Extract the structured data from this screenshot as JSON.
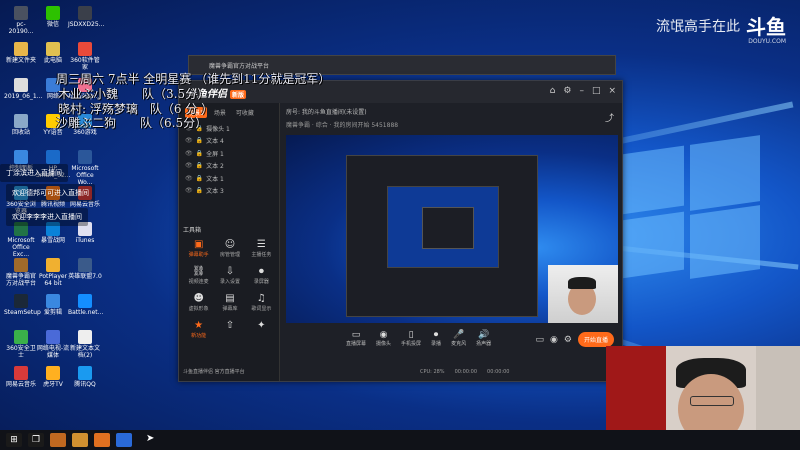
{
  "watermark": {
    "text": "流氓高手在此",
    "logo": "斗鱼",
    "url": "DOUYU.COM"
  },
  "overlay_lines": [
    "周三周六 7点半 全明星赛 （谁先到11分就是冠军）",
    "木业ぶ小魏　　队（3.5分）",
    "晓村: 浮殇梦璃　队（6 分 ）",
    "沙雕ぶ二狗　　队（6.5分）"
  ],
  "chat_messages": [
    "丁涂滨进入直播间",
    "欢迎德邦可可进入直播间",
    "欢迎李李李进入直播间"
  ],
  "desktop_icons": [
    {
      "label": "pc-20190...",
      "icon": "computer-icon",
      "color": "#4a5160"
    },
    {
      "label": "微信",
      "icon": "wechat-icon",
      "color": "#2dc100"
    },
    {
      "label": "JSDXXD25...",
      "icon": "file-icon",
      "color": "#3a3f4a"
    },
    {
      "label": "新建文件夹",
      "icon": "folder-icon",
      "color": "#e8b64a"
    },
    {
      "label": "此电脑",
      "icon": "pc-icon",
      "color": "#e0c050"
    },
    {
      "label": "360软件管家",
      "icon": "app-icon",
      "color": "#e94a3a"
    },
    {
      "label": "2019_06_1...",
      "icon": "file-icon",
      "color": "#ddd"
    },
    {
      "label": "网络",
      "icon": "network-icon",
      "color": "#3a7cd8"
    },
    {
      "label": "bilibiliupl...",
      "icon": "app-icon",
      "color": "#f07090"
    },
    {
      "label": "回收站",
      "icon": "recycle-bin-icon",
      "color": "#8aa8c8"
    },
    {
      "label": "YY语音",
      "icon": "app-icon",
      "color": "#ffcc00"
    },
    {
      "label": "360游戏",
      "icon": "app-icon",
      "color": "#2a8ad8"
    },
    {
      "label": "控制面板",
      "icon": "control-panel-icon",
      "color": "#3a88e0"
    },
    {
      "label": "HP Smart_02...",
      "icon": "app-icon",
      "color": "#1a6ac8"
    },
    {
      "label": "Microsoft Office Wo...",
      "icon": "word-icon",
      "color": "#2b579a"
    },
    {
      "label": "360安全浏览器",
      "icon": "browser-icon",
      "color": "#2a9ae0"
    },
    {
      "label": "腾讯视频",
      "icon": "app-icon",
      "color": "#ff7a1a"
    },
    {
      "label": "网易云音乐",
      "icon": "app-icon",
      "color": "#d83a3a"
    },
    {
      "label": "Microsoft Office Exc...",
      "icon": "excel-icon",
      "color": "#217346"
    },
    {
      "label": "暴雪战网",
      "icon": "app-icon",
      "color": "#0a82d8"
    },
    {
      "label": "iTunes",
      "icon": "app-icon",
      "color": "#e0e0f0"
    },
    {
      "label": "魔兽争霸官方对战平台",
      "icon": "app-icon",
      "color": "#a06a2a"
    },
    {
      "label": "PotPlayer 64 bit",
      "icon": "app-icon",
      "color": "#f0b030"
    },
    {
      "label": "英雄联盟7.0",
      "icon": "app-icon",
      "color": "#3a5a8a"
    },
    {
      "label": "SteamSetup",
      "icon": "steam-icon",
      "color": "#1b2838"
    },
    {
      "label": "爱剪辑",
      "icon": "app-icon",
      "color": "#3a88e0"
    },
    {
      "label": "Battle.net...",
      "icon": "app-icon",
      "color": "#148eff"
    },
    {
      "label": "360安全卫士",
      "icon": "app-icon",
      "color": "#3ab04a"
    },
    {
      "label": "网络电视-流媒体",
      "icon": "app-icon",
      "color": "#4a6ad8"
    },
    {
      "label": "新建文本文档(2)",
      "icon": "file-icon",
      "color": "#eee"
    },
    {
      "label": "网易云音乐",
      "icon": "app-icon",
      "color": "#d83a3a"
    },
    {
      "label": "虎牙TV",
      "icon": "app-icon",
      "color": "#ffb020"
    },
    {
      "label": "腾讯QQ",
      "icon": "qq-icon",
      "color": "#1a9af0"
    }
  ],
  "back_window": {
    "title": "魔兽争霸官方对战平台"
  },
  "obs": {
    "logo": "斗鱼伴侣",
    "badge": "新版",
    "tabs": [
      "场景1",
      "场景",
      "可收藏"
    ],
    "top_info": "房号: 我的斗鱼直播间(未设置)",
    "info_line2": "魔兽争霸 · 综合 · 我的房间开始 5451888",
    "scenes": [
      "摄像头 1",
      "文本 4",
      "全屏 1",
      "文本 2",
      "文本 1",
      "文本 3"
    ],
    "tools_title": "工具箱",
    "tools": [
      {
        "label": "弹幕助手",
        "icon": "danmaku-icon",
        "hot": true
      },
      {
        "label": "房管管理",
        "icon": "user-icon",
        "hot": false
      },
      {
        "label": "主播任务",
        "icon": "task-icon",
        "hot": false
      },
      {
        "label": "视频连麦",
        "icon": "link-icon",
        "hot": false
      },
      {
        "label": "录入设置",
        "icon": "download-icon",
        "hot": false
      },
      {
        "label": "录屏器",
        "icon": "record-icon",
        "hot": false
      },
      {
        "label": "虚拟形象",
        "icon": "avatar-icon",
        "hot": false
      },
      {
        "label": "弹幕库",
        "icon": "library-icon",
        "hot": false
      },
      {
        "label": "歌词显示",
        "icon": "lyrics-icon",
        "hot": false
      },
      {
        "label": "新功能",
        "icon": "new-icon",
        "hot": true
      },
      {
        "label": "",
        "icon": "upload-icon",
        "hot": false
      },
      {
        "label": "",
        "icon": "gift-icon",
        "hot": false
      }
    ],
    "bottom_left": "斗鱼直播伴侣 官方直播平台",
    "controls": [
      {
        "label": "直播屏幕",
        "icon": "screen-icon"
      },
      {
        "label": "摄像头",
        "icon": "camera-icon"
      },
      {
        "label": "手机投屏",
        "icon": "phone-icon"
      },
      {
        "label": "录播",
        "icon": "record-icon"
      },
      {
        "label": "麦克风",
        "icon": "mic-icon"
      },
      {
        "label": "扬声器",
        "icon": "speaker-icon"
      }
    ],
    "live_button": "开始直播",
    "status": [
      "CPU: 28%",
      "00:00:00",
      "00:00:00"
    ]
  },
  "taskbar": {
    "items": [
      {
        "icon": "windows-start-icon",
        "color": "#1a1a1a"
      },
      {
        "icon": "task-view-icon",
        "color": "#1a1a1a"
      },
      {
        "icon": "obs-app-icon",
        "color": "#c06820"
      },
      {
        "icon": "warcraft-icon",
        "color": "#d09030"
      },
      {
        "icon": "douyu-icon",
        "color": "#e07020"
      },
      {
        "icon": "app-icon",
        "color": "#2a6ad8"
      }
    ]
  }
}
